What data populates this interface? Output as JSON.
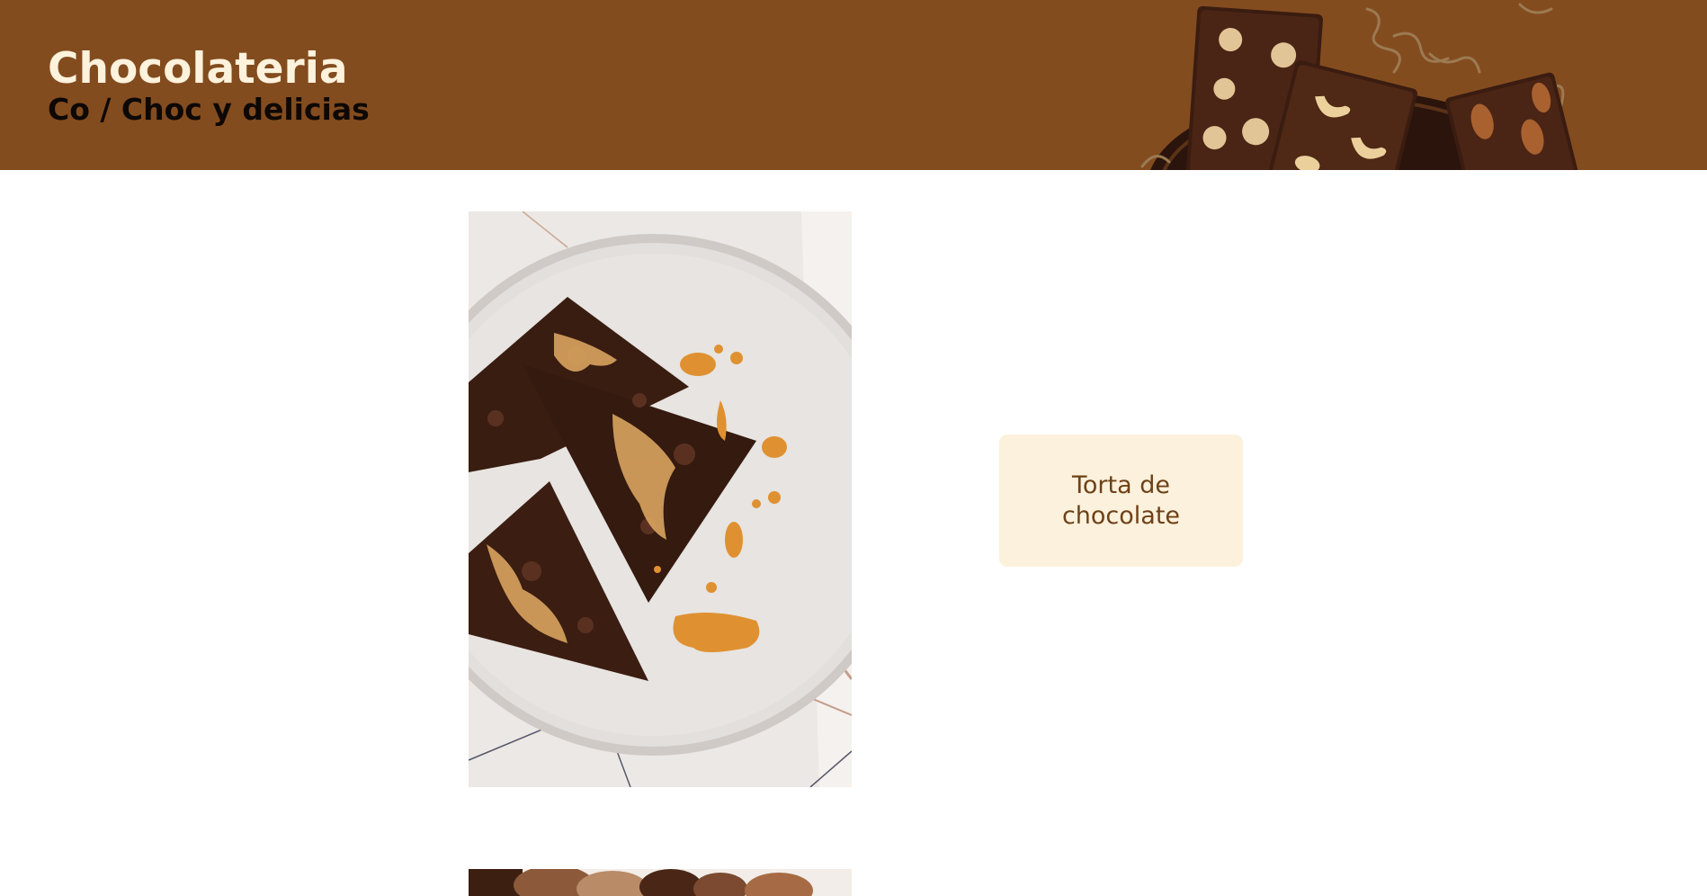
{
  "header": {
    "title": "Chocolateria",
    "subtitle": "Co / Choc y delicias",
    "banner_icon": "chocolate-bars-with-nuts-image"
  },
  "main": {
    "products": [
      {
        "image_icon": "chocolate-brownie-caramel-image",
        "name": "Torta de chocolate"
      },
      {
        "image_icon": "chocolate-truffles-image"
      }
    ]
  },
  "colors": {
    "header_background": "#834c1f",
    "title_color": "#fdf2dc",
    "subtitle_color": "#0d0805",
    "card_background": "#fcf1dc",
    "card_text": "#6e4117"
  }
}
